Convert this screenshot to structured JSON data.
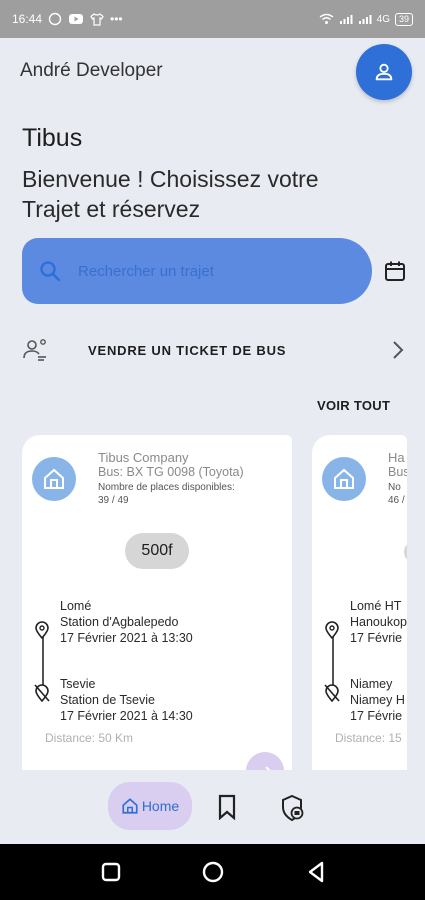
{
  "status_bar": {
    "time": "16:44",
    "dots": "•••",
    "signal_label": "4G",
    "battery": "39"
  },
  "header": {
    "user_name": "André Developer"
  },
  "hero": {
    "app_title": "Tibus",
    "subtitle": "Bienvenue ! Choisissez votre Trajet et réservez"
  },
  "search": {
    "placeholder": "Rechercher un trajet",
    "value": ""
  },
  "sell_ticket": {
    "label": "VENDRE UN TICKET DE BUS"
  },
  "trips_section": {
    "see_all_label": "VOIR TOUT"
  },
  "trips": [
    {
      "company": "Tibus Company",
      "bus": "Bus: BX TG 0098 (Toyota)",
      "seats_label": "Nombre de places disponibles:",
      "seats_value": "39 / 49",
      "price": "500f",
      "departure": {
        "city": "Lomé",
        "station": "Station d'Agbalepedo",
        "datetime": "17 Février 2021 à 13:30"
      },
      "arrival": {
        "city": "Tsevie",
        "station": "Station de Tsevie",
        "datetime": "17 Février 2021 à 14:30"
      },
      "distance": "Distance: 50 Km"
    },
    {
      "company": "Ha",
      "bus": "Bus",
      "seats_label": "No",
      "seats_value": "46 /",
      "departure": {
        "city": "Lomé HT",
        "station": "Hanoukop",
        "datetime": "17 Févrie"
      },
      "arrival": {
        "city": "Niamey",
        "station": "Niamey H",
        "datetime": "17 Févrie"
      },
      "distance": "Distance: 15"
    }
  ],
  "bottom_nav": {
    "home_label": "Home"
  },
  "colors": {
    "primary": "#2e6fd8",
    "search_bg": "#5b8ae0",
    "page_bg": "#e8ebf2",
    "nav_active_bg": "#d9cdf0",
    "company_icon_bg": "#89b4e8"
  },
  "icons": [
    "wifi-icon",
    "signal-icon",
    "person-icon",
    "search-icon",
    "calendar-icon",
    "seller-icon",
    "chevron-right-icon",
    "home-icon",
    "location-pin-icon",
    "location-off-icon",
    "arrow-right-icon",
    "bookmark-icon",
    "ticket-icon",
    "square-icon",
    "circle-icon",
    "triangle-back-icon"
  ]
}
